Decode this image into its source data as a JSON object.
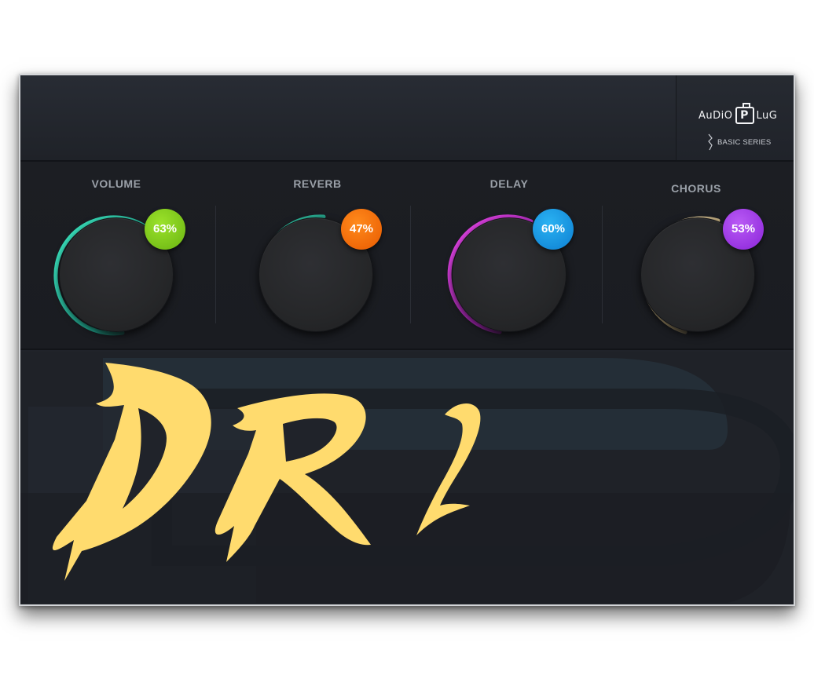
{
  "brand": {
    "logo_text_left": "AuDiO",
    "logo_text_plug": "P",
    "logo_text_right": "LuG",
    "series": "BASIC SERIES"
  },
  "knobs": [
    {
      "label": "VOLUME",
      "value": "63%",
      "ring_color": "#3ff0c8",
      "badge_color": "#7cd11a"
    },
    {
      "label": "REVERB",
      "value": "47%",
      "ring_color": "#3ff0c8",
      "badge_color": "#ff6a00"
    },
    {
      "label": "DELAY",
      "value": "60%",
      "ring_color": "#e23cf0",
      "badge_color": "#169ae8"
    },
    {
      "label": "CHORUS",
      "value": "53%",
      "ring_color": "#f2dcaa",
      "badge_color": "#a23cf0"
    }
  ],
  "product": {
    "logo_text": "DR",
    "logo_superscript": "2",
    "logo_color": "#ffdb6e"
  }
}
